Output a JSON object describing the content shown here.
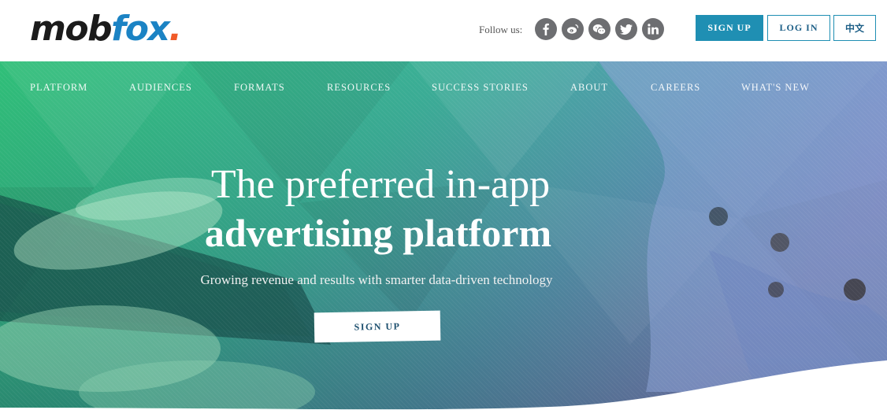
{
  "header": {
    "logo": {
      "part1": "mob",
      "part2": "fox",
      "dot": "."
    },
    "follow_label": "Follow us:",
    "socials": [
      {
        "name": "facebook-icon"
      },
      {
        "name": "weibo-icon"
      },
      {
        "name": "wechat-icon"
      },
      {
        "name": "twitter-icon"
      },
      {
        "name": "linkedin-icon"
      }
    ],
    "signup_label": "SIGN UP",
    "login_label": "LOG IN",
    "lang_label": "中文"
  },
  "nav": {
    "items": [
      "PLATFORM",
      "AUDIENCES",
      "FORMATS",
      "RESOURCES",
      "SUCCESS STORIES",
      "ABOUT",
      "CAREERS",
      "WHAT'S NEW"
    ]
  },
  "hero": {
    "headline_line1": "The preferred in-app",
    "headline_line2": "advertising platform",
    "subheadline": "Growing revenue and results with smarter data-driven technology",
    "cta_label": "SIGN UP"
  },
  "colors": {
    "brand_blue": "#1b83c4",
    "brand_orange": "#f05a28",
    "button_blue": "#1f8fb3",
    "hero_green": "#2fbf7a",
    "hero_teal": "#3aa3a0",
    "hero_purple": "#7c7cc8"
  }
}
